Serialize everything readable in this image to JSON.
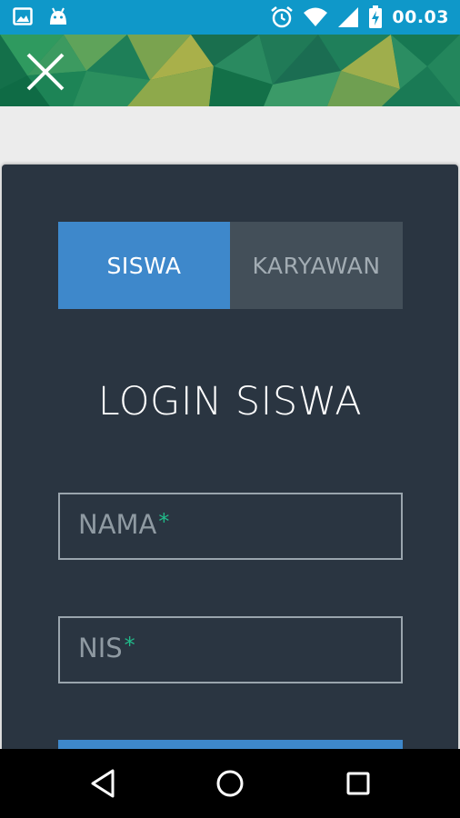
{
  "status_bar": {
    "time": "00.03",
    "icons": [
      "image-notification-icon",
      "android-notification-icon",
      "alarm-icon",
      "wifi-icon",
      "signal-icon",
      "battery-charging-icon"
    ]
  },
  "header": {
    "close_icon": "close-icon"
  },
  "tabs": [
    {
      "label": "SISWA",
      "active": true
    },
    {
      "label": "KARYAWAN",
      "active": false
    }
  ],
  "login": {
    "title": "LOGIN SISWA",
    "fields": [
      {
        "label": "NAMA",
        "required_mark": "*",
        "value": ""
      },
      {
        "label": "NIS",
        "required_mark": "*",
        "value": ""
      }
    ]
  },
  "colors": {
    "status_bar": "#0f98c9",
    "card": "#2a3541",
    "accent_blue": "#3e88cb",
    "inactive_tab": "#434f59",
    "required_green": "#21b989"
  },
  "nav_bar": {
    "buttons": [
      "back-icon",
      "home-icon",
      "recent-apps-icon"
    ]
  }
}
